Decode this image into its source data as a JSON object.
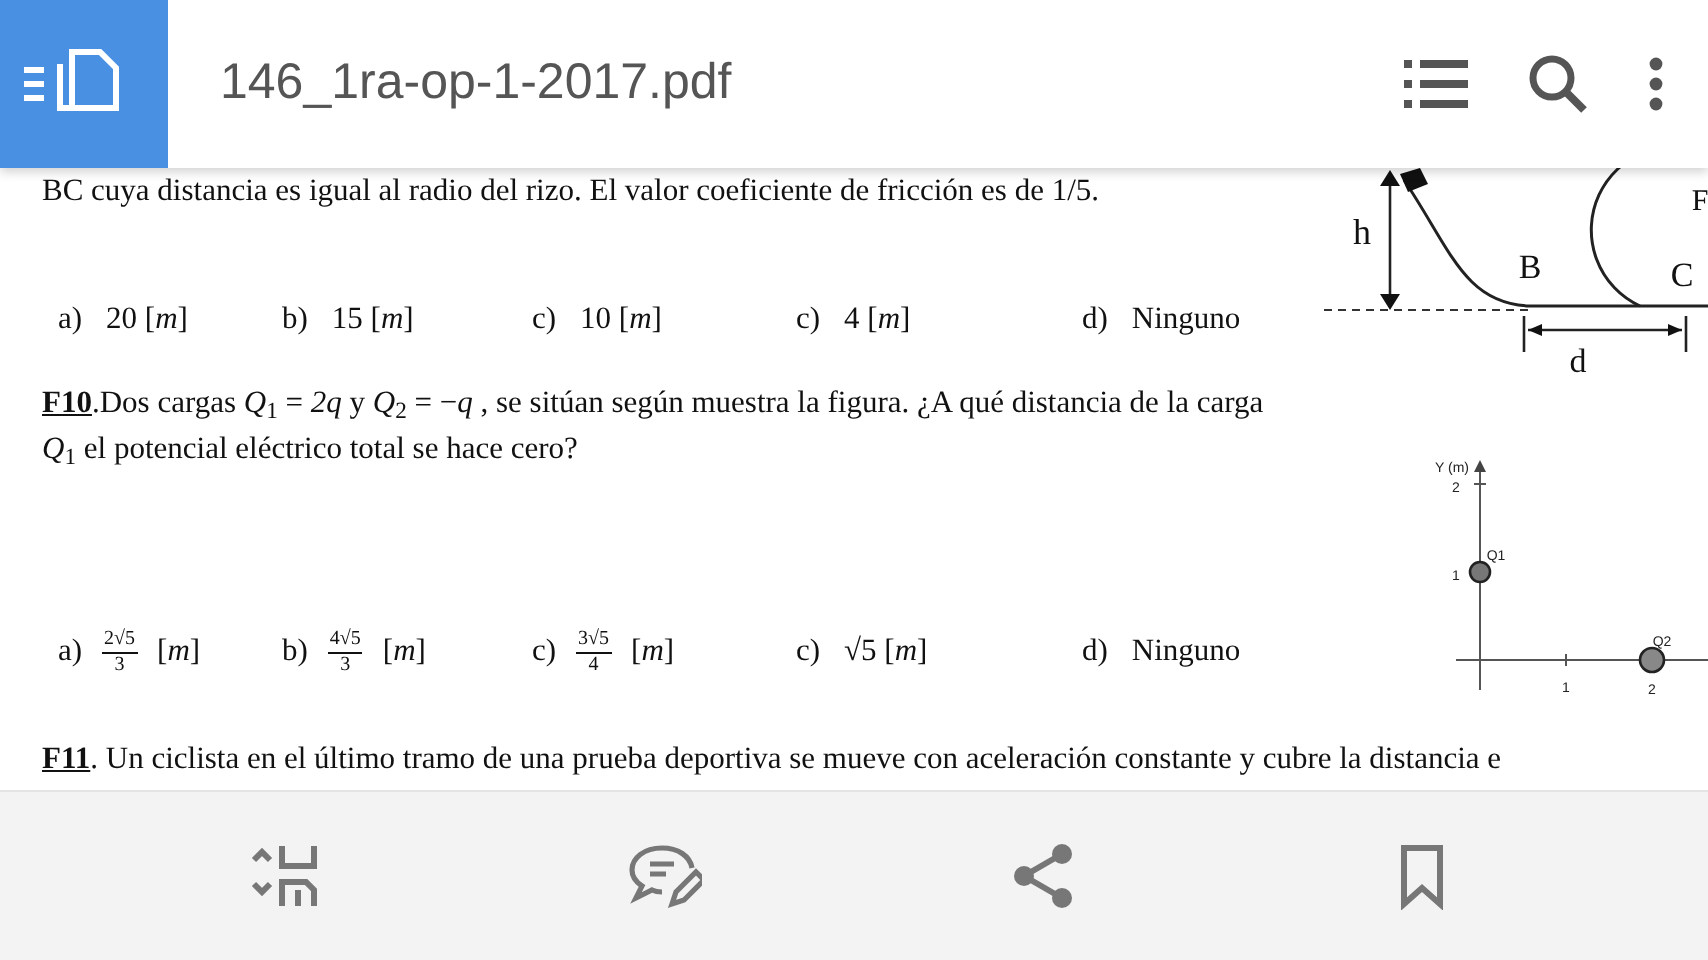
{
  "app_bar": {
    "title": "146_1ra-op-1-2017.pdf"
  },
  "document": {
    "sections": [
      {
        "text": "BC cuya distancia es igual al radio del rizo. El valor coeficiente de fricción es de 1/5.",
        "options": [
          {
            "kind": "plain",
            "letter": "a)",
            "text": "20 [*m*]"
          },
          {
            "kind": "plain",
            "letter": "b)",
            "text": "15 [*m*]"
          },
          {
            "kind": "plain",
            "letter": "c)",
            "text": "10 [*m*]"
          },
          {
            "kind": "plain",
            "letter": "c)",
            "text": "4 [*m*]"
          },
          {
            "kind": "plain",
            "letter": "d)",
            "text": "Ninguno"
          }
        ],
        "figure": {
          "kind": "loop",
          "labels": [
            "h",
            "B",
            "C",
            "d",
            "F"
          ]
        }
      },
      {
        "text": "**F10**.Dos cargas *Q*$_{1}$ = *2q* y  *Q*$_{2}$ = −*q* , se sitúan según muestra la figura. ¿A qué distancia de la carga *Q*$_{1}$ el potencial eléctrico total se hace cero?",
        "options": [
          {
            "kind": "fraction",
            "letter": "a)",
            "numerator": "2√5",
            "denominator": "3",
            "text": "[*m*]"
          },
          {
            "kind": "fraction",
            "letter": "b)",
            "numerator": "4√5",
            "denominator": "3",
            "text": "[*m*]"
          },
          {
            "kind": "fraction",
            "letter": "c)",
            "numerator": "3√5",
            "denominator": "4",
            "text": "[*m*]"
          },
          {
            "kind": "plain",
            "letter": "c)",
            "text": "√5 [*m*]"
          },
          {
            "kind": "plain",
            "letter": "d)",
            "text": "Ninguno"
          }
        ],
        "figure": {
          "kind": "axes",
          "labels": [
            "Y (m)",
            "2",
            "1",
            "Q1",
            "1",
            "2",
            "Q2"
          ]
        }
      },
      {
        "text": "**F11**. Un ciclista en el último tramo de una prueba deportiva se mueve con aceleración constante y cubre la distancia e"
      }
    ]
  }
}
